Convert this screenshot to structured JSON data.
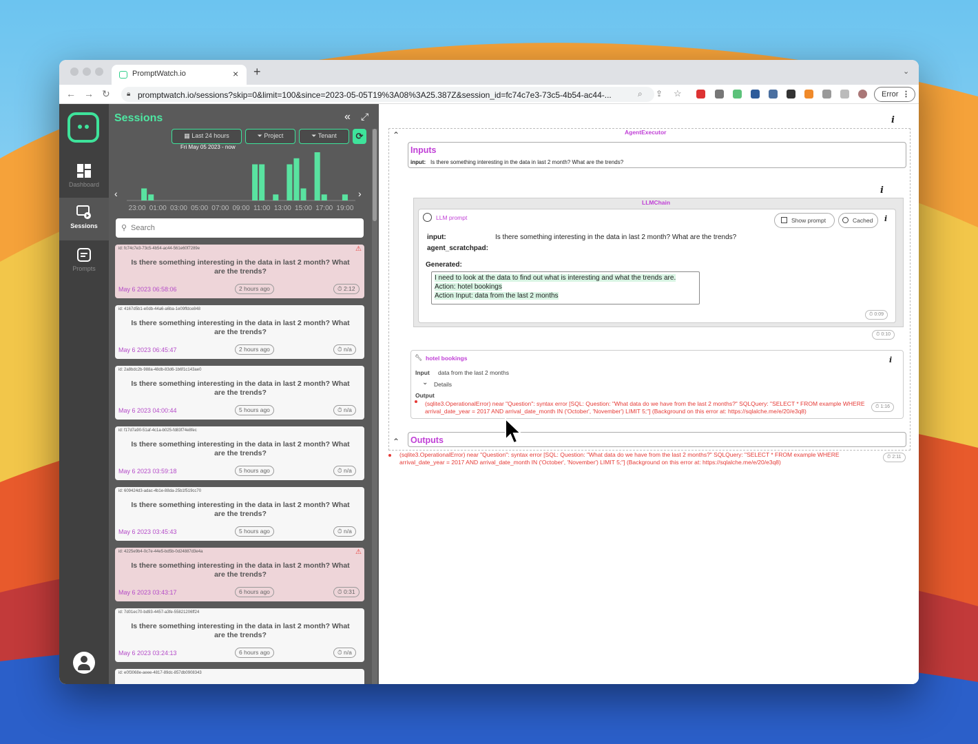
{
  "colors": {
    "accent": "#3ee39b",
    "magenta": "#c03fd6",
    "error": "#e53935",
    "rail": "#404040",
    "panel": "#5a5a5a"
  },
  "browser": {
    "tab_title": "PromptWatch.io",
    "url": "promptwatch.io/sessions?skip=0&limit=100&since=2023-05-05T19%3A08%3A25.387Z&session_id=fc74c7e3-73c5-4b54-ac44-...",
    "error_label": "Error"
  },
  "rail": {
    "items": [
      {
        "label": "Dashboard",
        "icon": "dashboard-icon"
      },
      {
        "label": "Sessions",
        "icon": "sessions-icon"
      },
      {
        "label": "Prompts",
        "icon": "prompts-icon"
      }
    ]
  },
  "sessions": {
    "title": "Sessions",
    "filters": {
      "time": "Last 24 hours",
      "project": "Project",
      "tenant": "Tenant"
    },
    "date_range": "Fri May 05 2023 - now",
    "search_placeholder": "Search",
    "histogram": {
      "ticks": [
        "23:00",
        "01:00",
        "03:00",
        "05:00",
        "07:00",
        "09:00",
        "11:00",
        "13:00",
        "15:00",
        "17:00",
        "19:00"
      ],
      "values": [
        0,
        0,
        2,
        1,
        0,
        0,
        0,
        0,
        0,
        0,
        0,
        0,
        0,
        0,
        0,
        0,
        0,
        0,
        6,
        6,
        0,
        1,
        0,
        6,
        7,
        2,
        0,
        8,
        1,
        0,
        0,
        1,
        0
      ]
    },
    "items": [
      {
        "id": "id: fc74c7e3-73c5-4b54-ac44-561e60f7289e",
        "question": "Is there something interesting in the data in last 2 month? What are the trends?",
        "date": "May 6 2023 06:58:06",
        "ago": "2 hours ago",
        "duration": "2:12",
        "error": true
      },
      {
        "id": "id: 4167d5b1-e0db-44a6-a6ba-1e09ffdce848",
        "question": "Is there something interesting in the data in last 2 month? What are the trends?",
        "date": "May 6 2023 06:45:47",
        "ago": "2 hours ago",
        "duration": "n/a",
        "error": false
      },
      {
        "id": "id: 2a8bdc2b-988a-48db-83d6-1b6f1c143ae0",
        "question": "Is there something interesting in the data in last 2 month? What are the trends?",
        "date": "May 6 2023 04:00:44",
        "ago": "5 hours ago",
        "duration": "n/a",
        "error": false
      },
      {
        "id": "id: f17d7a90-51af-4c1a-b025-fd83f74e8fec",
        "question": "Is there something interesting in the data in last 2 month? What are the trends?",
        "date": "May 6 2023 03:59:18",
        "ago": "5 hours ago",
        "duration": "n/a",
        "error": false
      },
      {
        "id": "id: 609424d3-adac-4b1e-88da-25b1f519cc70",
        "question": "Is there something interesting in the data in last 2 month? What are the trends?",
        "date": "May 6 2023 03:45:43",
        "ago": "5 hours ago",
        "duration": "n/a",
        "error": false
      },
      {
        "id": "id: 4225e9b4-0c7e-44e5-bd5b-0d24887d3e4a",
        "question": "Is there something interesting in the data in last 2 month? What are the trends?",
        "date": "May 6 2023 03:43:17",
        "ago": "6 hours ago",
        "duration": "0:31",
        "error": true
      },
      {
        "id": "id: 7d01ec70-bd93-4457-a3fe-55821206ff24",
        "question": "Is there something interesting in the data in last 2 month? What are the trends?",
        "date": "May 6 2023 03:24:13",
        "ago": "6 hours ago",
        "duration": "n/a",
        "error": false
      },
      {
        "id": "id: e0f3068e-aeee-4817-89dc-857db0908343",
        "question": "",
        "date": "",
        "ago": "",
        "duration": "",
        "error": false
      }
    ]
  },
  "detail": {
    "agent_tag": "AgentExecutor",
    "inputs_title": "Inputs",
    "input_key": "input:",
    "input_value": "Is there something interesting in the data in last 2 month? What are the trends?",
    "llmchain_tag": "LLMChain",
    "llm_prompt_label": "LLM prompt",
    "show_prompt": "Show prompt",
    "cached": "Cached",
    "fields": [
      {
        "key": "input:",
        "value": "Is there something interesting in the data in last 2 month? What are the trends?"
      },
      {
        "key": "agent_scratchpad:",
        "value": ""
      }
    ],
    "generated_label": "Generated:",
    "generated_lines": [
      "I need to look at the data to find out what is interesting and what the trends are.",
      "Action: hotel bookings",
      "Action Input: data from the last 2 months"
    ],
    "prompt_time": "0:09",
    "chain_time": "0:10",
    "tool_title": "hotel bookings",
    "tool_input_label": "Input",
    "tool_input_value": "data from the last 2 months",
    "details_label": "Details",
    "output_label": "Output",
    "tool_error": "(sqlite3.OperationalError) near \"Question\": syntax error [SQL: Question: \"What data do we have from the last 2 months?\" SQLQuery: \"SELECT * FROM example WHERE arrival_date_year = 2017 AND arrival_date_month IN ('October', 'November') LIMIT 5;\"] (Background on this error at: https://sqlalche.me/e/20/e3q8)",
    "tool_time": "1:16",
    "outputs_title": "Outputs",
    "final_error": "(sqlite3.OperationalError) near \"Question\": syntax error [SQL: Question: \"What data do we have from the last 2 months?\" SQLQuery: \"SELECT * FROM example WHERE arrival_date_year = 2017 AND arrival_date_month IN ('October', 'November') LIMIT 5;\"] (Background on this error at: https://sqlalche.me/e/20/e3q8)",
    "total_time": "2:11"
  }
}
